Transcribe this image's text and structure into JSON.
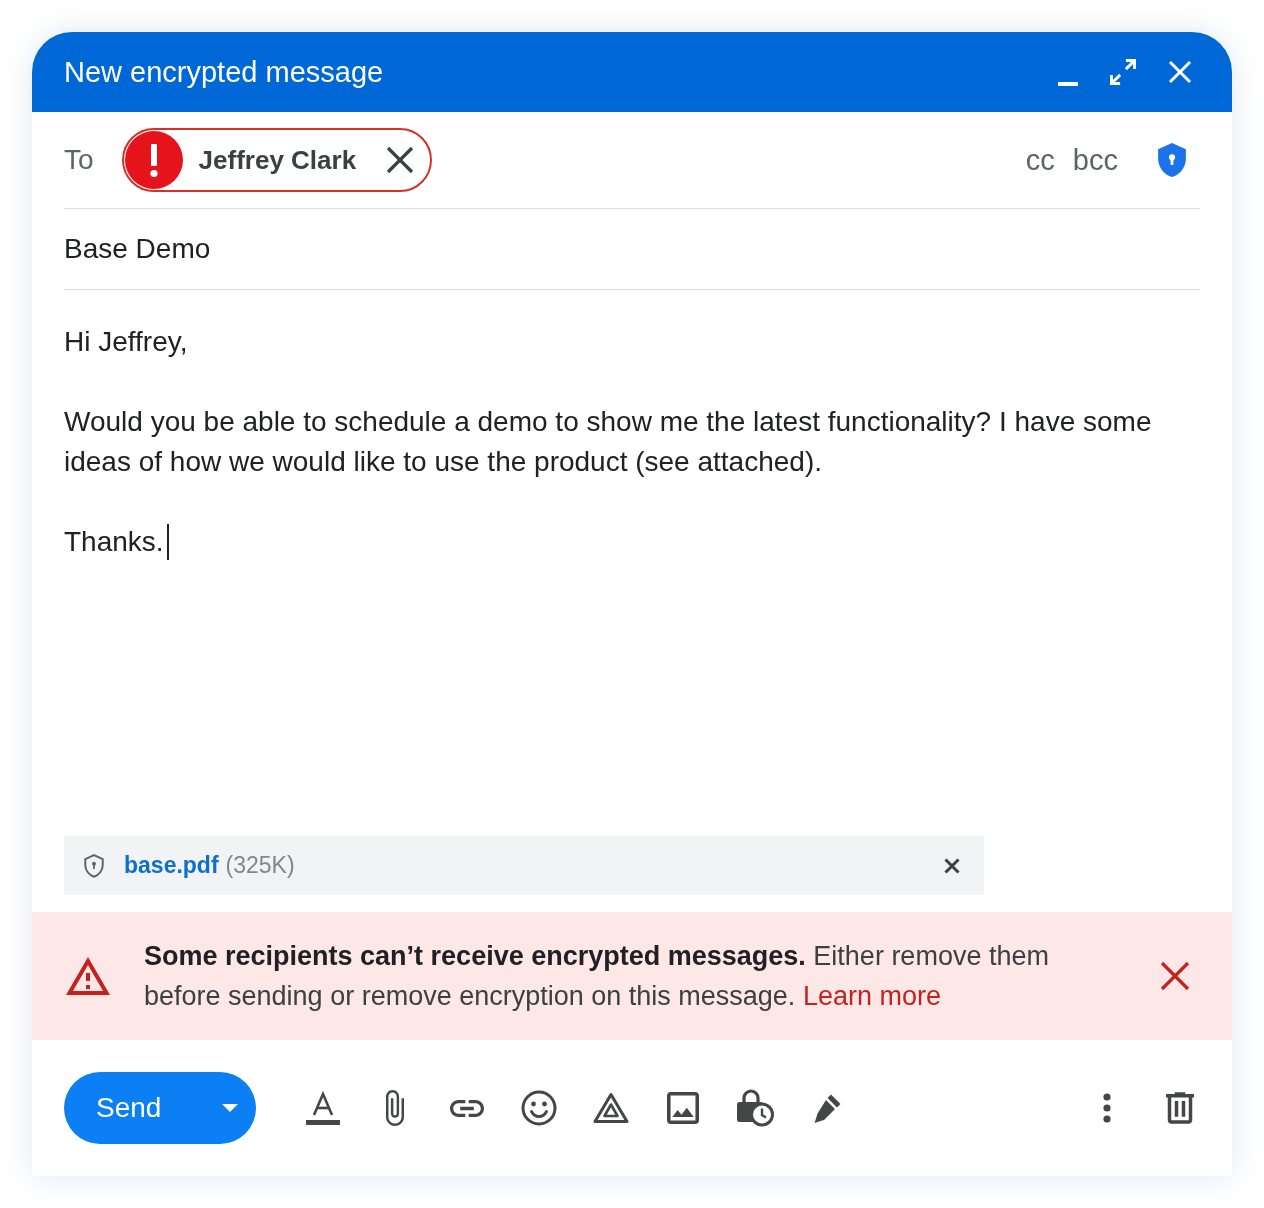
{
  "window": {
    "title": "New encrypted message"
  },
  "recipients": {
    "label": "To",
    "chips": [
      {
        "name": "Jeffrey Clark",
        "error": true
      }
    ],
    "cc": "cc",
    "bcc": "bcc"
  },
  "subject": {
    "value": "Base Demo"
  },
  "body": {
    "paragraphs": [
      "Hi Jeffrey,",
      "Would you be able to schedule a demo to show me the latest functionality? I have some ideas of how we would like to use the product (see attached).",
      "Thanks."
    ],
    "focused": true
  },
  "attachments": [
    {
      "name": "base.pdf",
      "size": "(325K)"
    }
  ],
  "warning": {
    "message": "**Some recipients can’t receive encrypted messages.** Either remove them before sending or remove encryption on this message.",
    "link": "Learn more"
  },
  "toolbar": {
    "send": "Send"
  }
}
